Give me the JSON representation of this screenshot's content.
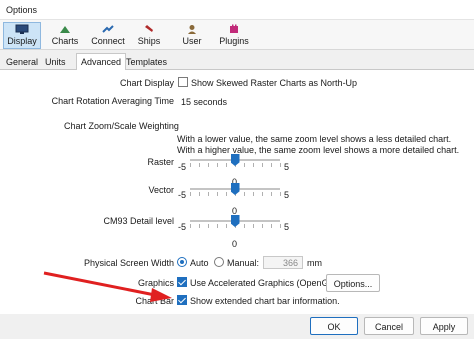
{
  "window": {
    "title": "Options"
  },
  "toolbar": {
    "items": [
      {
        "label": "Display",
        "icon": "monitor-icon",
        "active": true
      },
      {
        "label": "Charts",
        "icon": "charts-icon"
      },
      {
        "label": "Connect",
        "icon": "connect-icon"
      },
      {
        "label": "Ships",
        "icon": "ship-icon"
      },
      {
        "label": "User",
        "icon": "user-icon"
      },
      {
        "label": "Plugins",
        "icon": "plugins-icon"
      }
    ]
  },
  "tabs": [
    "General",
    "Units",
    "Advanced",
    "Templates"
  ],
  "active_tab": "Advanced",
  "settings": {
    "chart_display": {
      "label": "Chart Display",
      "option": "Show Skewed Raster Charts as North-Up",
      "checked": false
    },
    "rotation": {
      "label": "Chart Rotation Averaging Time",
      "value": "15 seconds"
    },
    "zoom": {
      "label": "Chart Zoom/Scale Weighting",
      "desc1": "With a lower value, the same zoom level shows a less detailed chart.",
      "desc2": "With a higher value, the same zoom level shows a more detailed chart."
    },
    "raster": {
      "label": "Raster",
      "min": "-5",
      "max": "5",
      "value": "0",
      "level": 0
    },
    "vector": {
      "label": "Vector",
      "min": "-5",
      "max": "5",
      "value": "0",
      "level": 0
    },
    "cm93": {
      "label": "CM93 Detail level",
      "min": "-5",
      "max": "5",
      "value": "0",
      "level": 0
    },
    "screen_width": {
      "label": "Physical Screen Width",
      "auto": "Auto",
      "manual": "Manual:",
      "value": "366",
      "unit": "mm",
      "selected": "Auto"
    },
    "graphics": {
      "label": "Graphics",
      "option": "Use Accelerated Graphics (OpenGL)",
      "checked": true,
      "button": "Options..."
    },
    "chart_bar": {
      "label": "Chart Bar",
      "option": "Show extended chart bar information.",
      "checked": true
    }
  },
  "buttons": {
    "ok": "OK",
    "cancel": "Cancel",
    "apply": "Apply"
  },
  "colors": {
    "accent": "#1f6fbf",
    "annotation_arrow": "#e02020"
  }
}
